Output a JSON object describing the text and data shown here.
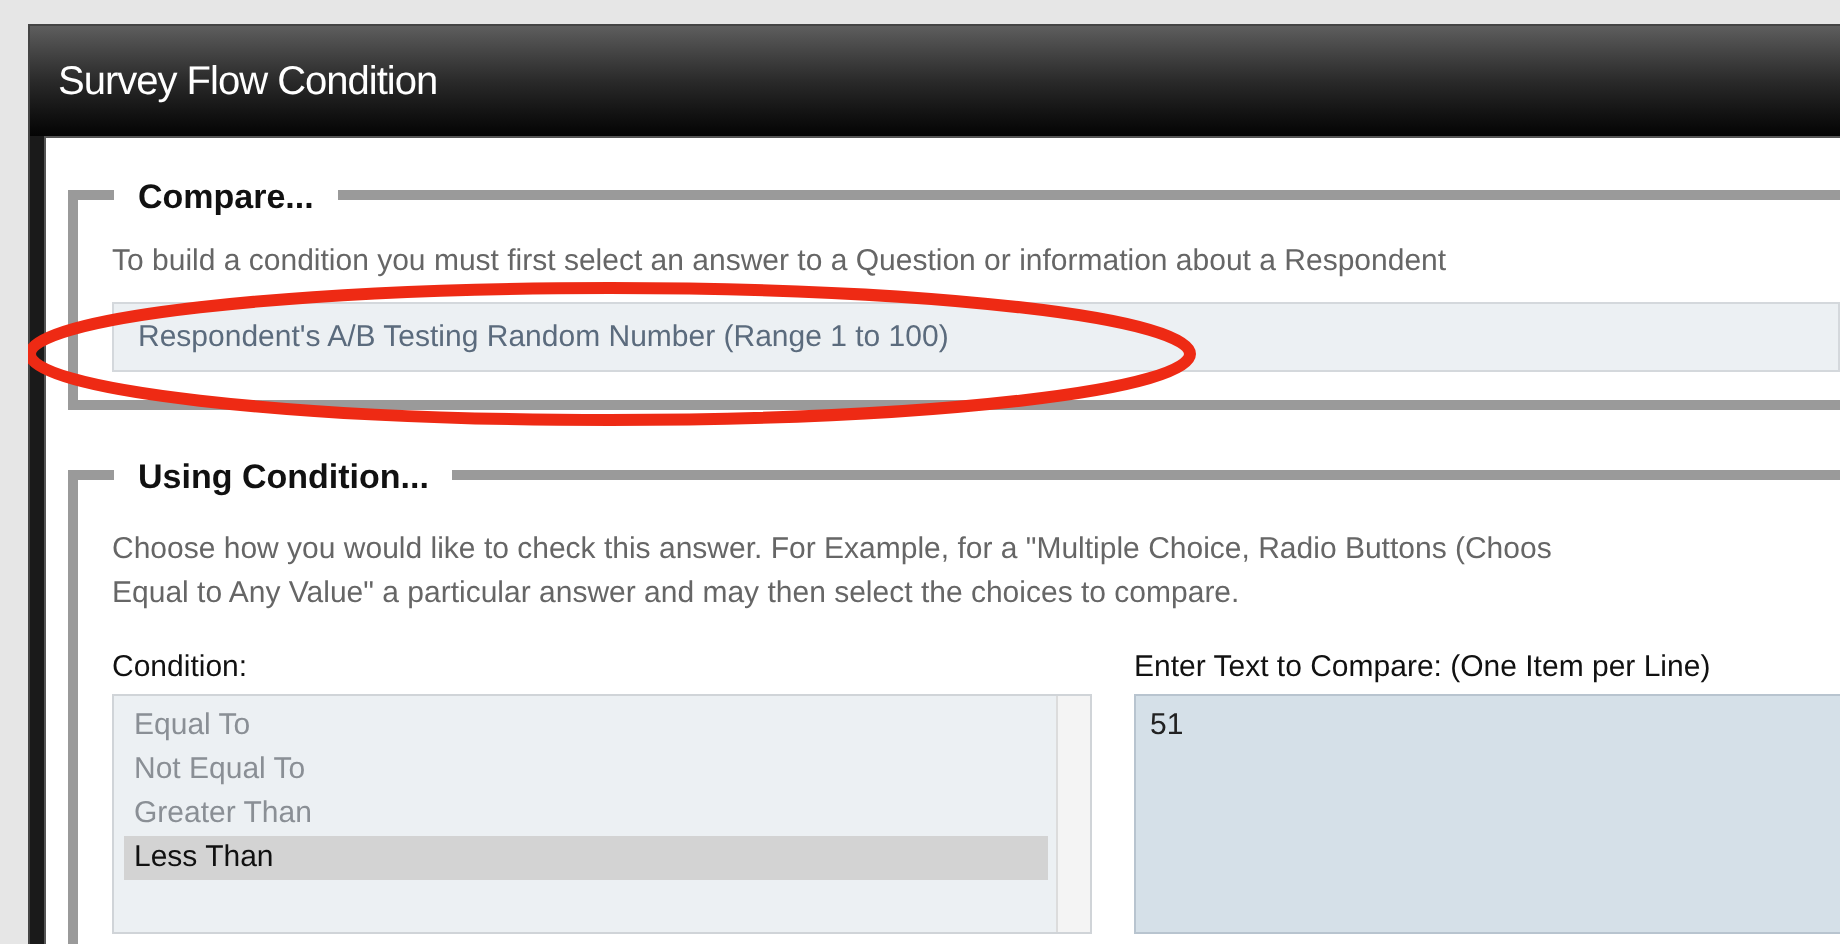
{
  "window": {
    "title": "Survey Flow Condition"
  },
  "compare": {
    "legend": "Compare...",
    "instruction": "To build a condition you must first select an answer to a Question or information about a Respondent",
    "field": {
      "value": "Respondent's A/B Testing Random Number (Range 1 to 100)"
    }
  },
  "using_condition": {
    "legend": "Using Condition...",
    "description_lines": [
      "Choose how you would like to check this answer. For Example, for a \"Multiple Choice, Radio Buttons (Choos",
      "Equal to Any Value\" a particular answer and may then select the choices to compare."
    ],
    "condition": {
      "label": "Condition:",
      "options": [
        {
          "label": "Equal To",
          "selected": false
        },
        {
          "label": "Not Equal To",
          "selected": false
        },
        {
          "label": "Greater Than",
          "selected": false
        },
        {
          "label": "Less Than",
          "selected": true
        }
      ]
    },
    "compare_text": {
      "label": "Enter Text to Compare: (One Item per Line)",
      "value": "51"
    }
  }
}
